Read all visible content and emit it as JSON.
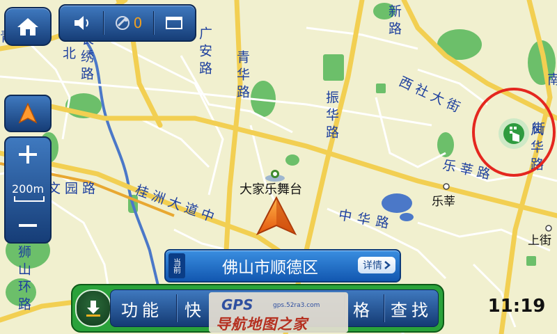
{
  "status_bar": {
    "satellite_count": "0"
  },
  "scale": "200m",
  "pois": {
    "stage": "大家乐舞台",
    "lexin": "乐莘",
    "shangjie": "上街"
  },
  "roads": {
    "guangan": "广安路",
    "qinghua": "青华路",
    "zhenhua": "振华路",
    "xin": "新路",
    "xishe": "西社大街",
    "changxiu": "长绣路",
    "bei": "北",
    "wenyuan": "文园路",
    "guizhou": "桂洲大道中",
    "lexin": "乐莘路",
    "fenghua": "风华路",
    "zhonghua": "中华路",
    "shishan": "狮山环路",
    "nan": "南",
    "qing": "青",
    "jie": "街"
  },
  "location": {
    "tag": "当前",
    "name": "佛山市顺德区",
    "details_label": "详情"
  },
  "menu": {
    "function": "功能",
    "quick": "快",
    "price": "格",
    "search": "查找"
  },
  "watermark": {
    "logo": "GPS",
    "url": "gps.52ra3.com",
    "title": "导航地图之家"
  },
  "clock": "11:19",
  "colors": {
    "map_bg": "#f1f0cf",
    "road": "#f2cf52",
    "label": "#1d3f9e",
    "park": "#6cbf6a",
    "water": "#4b78c8",
    "annotation": "#e4271f"
  }
}
